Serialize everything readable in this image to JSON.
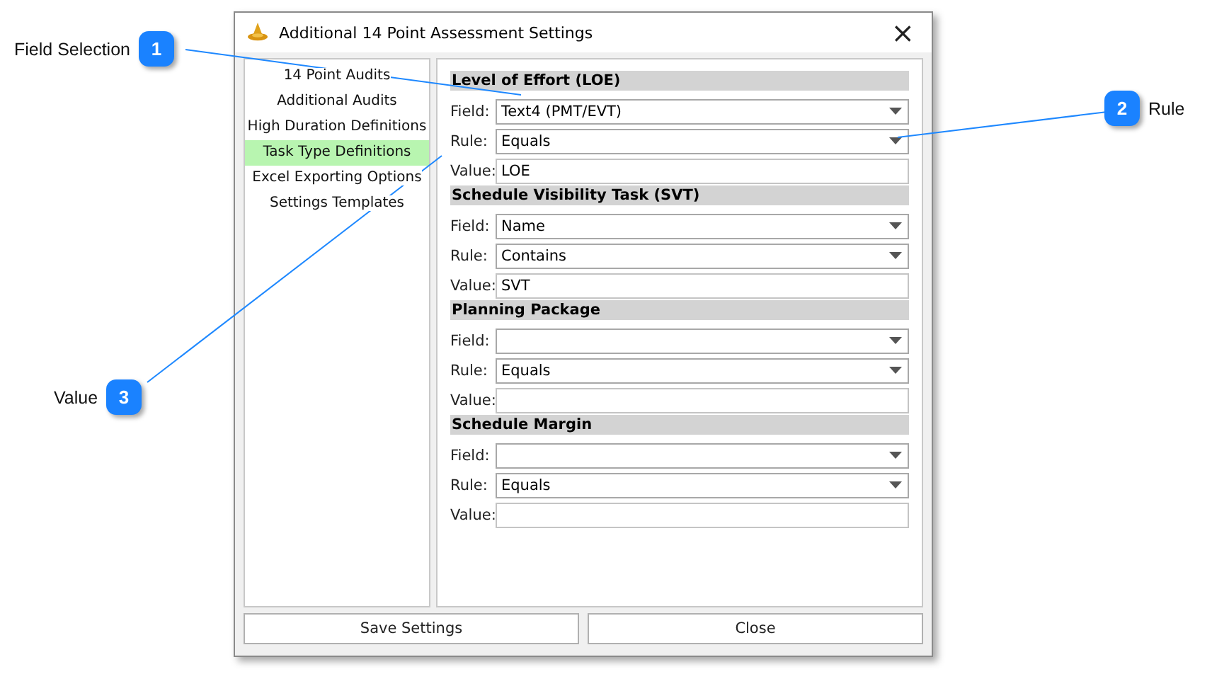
{
  "window": {
    "title": "Additional 14 Point Assessment Settings",
    "close": "×"
  },
  "nav": {
    "items": [
      {
        "label": "14 Point Audits",
        "selected": false
      },
      {
        "label": "Additional Audits",
        "selected": false
      },
      {
        "label": "High Duration Definitions",
        "selected": false
      },
      {
        "label": "Task Type Definitions",
        "selected": true
      },
      {
        "label": "Excel Exporting Options",
        "selected": false
      },
      {
        "label": "Settings Templates",
        "selected": false
      }
    ]
  },
  "sections": [
    {
      "title": "Level of Effort (LOE)",
      "rows": [
        {
          "label": "Field:",
          "kind": "dropdown",
          "value": "Text4 (PMT/EVT)"
        },
        {
          "label": "Rule:",
          "kind": "dropdown",
          "value": "Equals"
        },
        {
          "label": "Value:",
          "kind": "text",
          "value": "LOE"
        }
      ]
    },
    {
      "title": "Schedule Visibility Task (SVT)",
      "rows": [
        {
          "label": "Field:",
          "kind": "dropdown",
          "value": "Name"
        },
        {
          "label": "Rule:",
          "kind": "dropdown",
          "value": "Contains"
        },
        {
          "label": "Value:",
          "kind": "text",
          "value": "SVT"
        }
      ]
    },
    {
      "title": "Planning Package",
      "rows": [
        {
          "label": "Field:",
          "kind": "dropdown"
        },
        {
          "label": "Rule:",
          "kind": "dropdown",
          "value": "Equals"
        },
        {
          "label": "Value:",
          "kind": "text"
        }
      ]
    },
    {
      "title": "Schedule Margin",
      "rows": [
        {
          "label": "Field:",
          "kind": "dropdown"
        },
        {
          "label": "Rule:",
          "kind": "dropdown",
          "value": "Equals"
        },
        {
          "label": "Value:",
          "kind": "text"
        }
      ]
    }
  ],
  "buttons": [
    "Save Settings",
    "Close"
  ],
  "callouts": [
    {
      "number": "1",
      "label": "Field Selection"
    },
    {
      "number": "2",
      "label": "Rule"
    },
    {
      "number": "3",
      "label": "Value"
    }
  ]
}
